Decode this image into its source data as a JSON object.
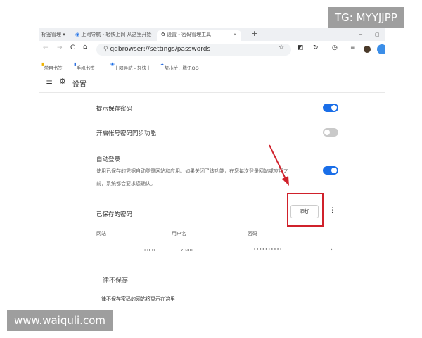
{
  "overlay": {
    "top_right": "TG: MYYJJPP",
    "bottom_left": "www.waiquli.com"
  },
  "tabs": [
    {
      "label": "标签管理 ▾"
    },
    {
      "label": "上网导航 - 轻快上网 从这里开始"
    },
    {
      "label": "设置 - 密码管理工具",
      "active": true
    }
  ],
  "tab_close": "×",
  "new_tab": "+",
  "window_min": "−",
  "window_max": "▢",
  "address": {
    "url": "qqbrowser://settings/passwords"
  },
  "bookmarks": [
    "常用书签",
    "手机书签",
    "上网导航 - 轻快上",
    "帮小忙，腾讯QQ"
  ],
  "header": {
    "title": "设置"
  },
  "settings": {
    "offer_save": {
      "label": "提示保存密码",
      "enabled": true
    },
    "sync": {
      "label": "开启帐号密码同步功能",
      "enabled": false
    },
    "auto_login": {
      "label": "自动登录",
      "desc1": "使用已保存的凭据自动登录网站和应用。如果关闭了该功能，在您每次登录网站或应用之",
      "desc2": "前，系统都会要求您确认。",
      "enabled": true
    }
  },
  "saved": {
    "title": "已保存的密码",
    "add_label": "添加",
    "columns": [
      "网站",
      "用户名",
      "密码"
    ],
    "entries": [
      {
        "site": ".com",
        "user": "zhan",
        "password": "••••••••••"
      }
    ]
  },
  "never": {
    "title": "一律不保存",
    "desc": "一律不保存密码的网站将显示在这里"
  },
  "colors": {
    "accent": "#1a6ee8",
    "annotation": "#d0212b"
  }
}
